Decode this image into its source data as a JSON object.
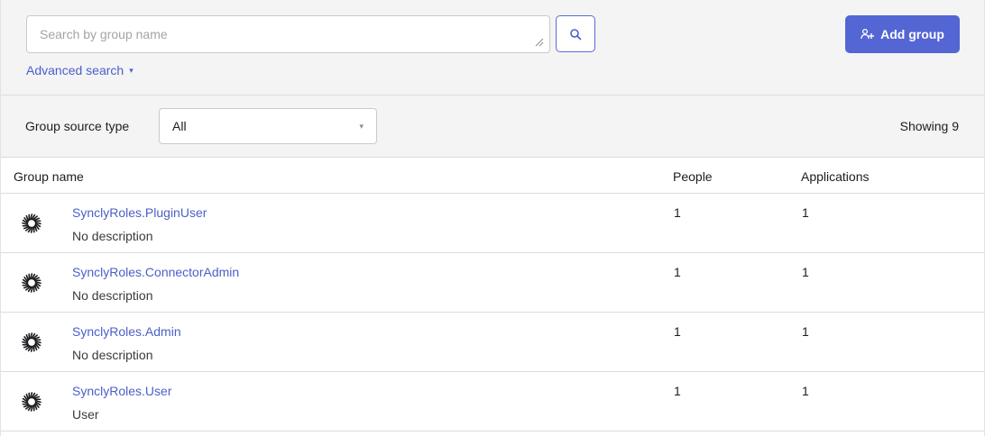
{
  "search": {
    "placeholder": "Search by group name",
    "value": "",
    "advanced_label": "Advanced search",
    "advanced_caret": "▾"
  },
  "toolbar": {
    "add_group_label": "Add group"
  },
  "filter": {
    "label": "Group source type",
    "selected": "All",
    "caret": "▾",
    "showing": "Showing 9"
  },
  "table": {
    "columns": {
      "name": "Group name",
      "people": "People",
      "applications": "Applications"
    },
    "rows": [
      {
        "name": "SynclyRoles.PluginUser",
        "description": "No description",
        "people": "1",
        "applications": "1",
        "icon": "group-logo-icon"
      },
      {
        "name": "SynclyRoles.ConnectorAdmin",
        "description": "No description",
        "people": "1",
        "applications": "1",
        "icon": "group-logo-icon"
      },
      {
        "name": "SynclyRoles.Admin",
        "description": "No description",
        "people": "1",
        "applications": "1",
        "icon": "group-logo-icon"
      },
      {
        "name": "SynclyRoles.User",
        "description": "User",
        "people": "1",
        "applications": "1",
        "icon": "group-logo-icon"
      }
    ]
  },
  "colors": {
    "accent": "#5466d4",
    "link": "#4b5fc9",
    "panel_bg": "#f4f4f5",
    "border": "#dcdce0"
  }
}
